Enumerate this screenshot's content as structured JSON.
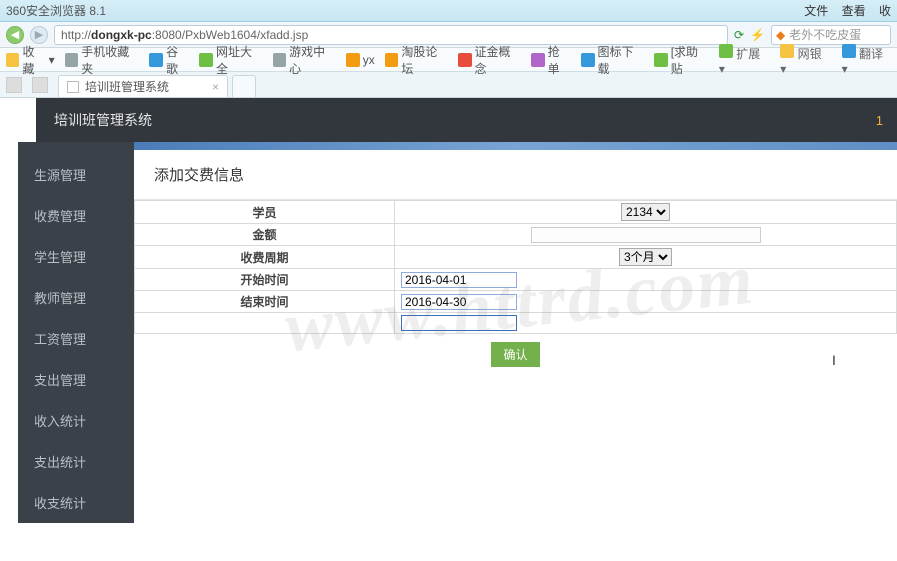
{
  "browser": {
    "title": "360安全浏览器 8.1",
    "menu": {
      "file": "文件",
      "view": "查看",
      "favorites": "收"
    },
    "url_prefix": "http://",
    "url_host": "dongxk-pc",
    "url_rest": ":8080/PxbWeb1604/xfadd.jsp",
    "refresh_icon": "⟳",
    "lightning_icon": "⚡",
    "search_placeholder": "老外不吃皮蛋",
    "bookmarks": {
      "fav": "收藏",
      "items": [
        "手机收藏夹",
        "谷歌",
        "网址大全",
        "游戏中心",
        "yx",
        "淘股论坛",
        "证金概念",
        "抢单",
        "图标下载",
        "[求助贴"
      ],
      "right": [
        "扩展",
        "网银",
        "翻译"
      ]
    },
    "tab_title": "培训班管理系统"
  },
  "app": {
    "header_title": "培训班管理系统",
    "notif": "1",
    "sidebar": [
      {
        "label": "生源管理"
      },
      {
        "label": "收费管理"
      },
      {
        "label": "学生管理"
      },
      {
        "label": "教师管理"
      },
      {
        "label": "工资管理"
      },
      {
        "label": "支出管理"
      },
      {
        "label": "收入统计"
      },
      {
        "label": "支出统计"
      },
      {
        "label": "收支统计"
      }
    ],
    "page_title": "添加交费信息",
    "form": {
      "student_label": "学员",
      "student_value": "2134",
      "amount_label": "金额",
      "amount_value": "",
      "cycle_label": "收费周期",
      "cycle_value": "3个月",
      "start_label": "开始时间",
      "start_value": "2016-04-01",
      "end_label": "结束时间",
      "end_value": "2016-04-30",
      "extra_value": ""
    },
    "confirm_label": "确认",
    "watermark": "www.httrd.com"
  }
}
